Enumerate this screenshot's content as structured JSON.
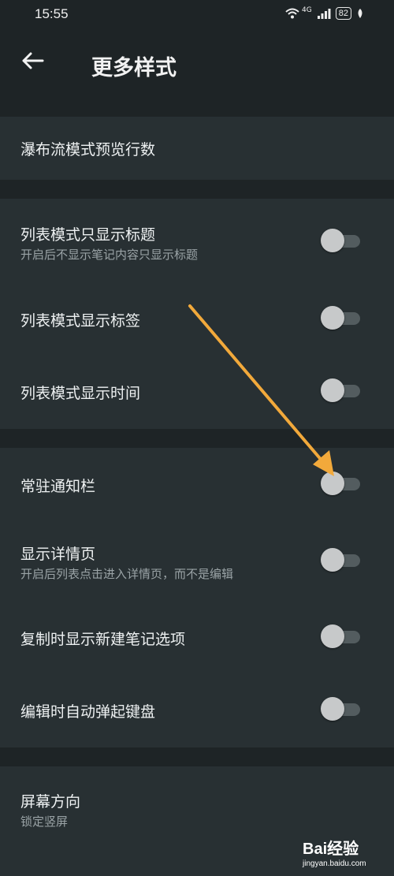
{
  "status_bar": {
    "time": "15:55",
    "network": "4G",
    "battery": "82"
  },
  "header": {
    "title": "更多样式"
  },
  "sections": [
    {
      "items": [
        {
          "label": "瀑布流模式预览行数"
        }
      ]
    },
    {
      "items": [
        {
          "label": "列表模式只显示标题",
          "sublabel": "开启后不显示笔记内容只显示标题",
          "toggle": false
        },
        {
          "label": "列表模式显示标签",
          "toggle": false
        },
        {
          "label": "列表模式显示时间",
          "toggle": false
        }
      ]
    },
    {
      "items": [
        {
          "label": "常驻通知栏",
          "toggle": false
        },
        {
          "label": "显示详情页",
          "sublabel": "开启后列表点击进入详情页，而不是编辑",
          "toggle": false
        },
        {
          "label": "复制时显示新建笔记选项",
          "toggle": false
        },
        {
          "label": "编辑时自动弹起键盘",
          "toggle": false
        }
      ]
    },
    {
      "items": [
        {
          "label": "屏幕方向",
          "sublabel": "锁定竖屏"
        }
      ]
    }
  ],
  "annotation": {
    "color": "#f2a93b"
  },
  "watermark": {
    "brand": "Bai经验",
    "url": "jingyan.baidu.com"
  }
}
